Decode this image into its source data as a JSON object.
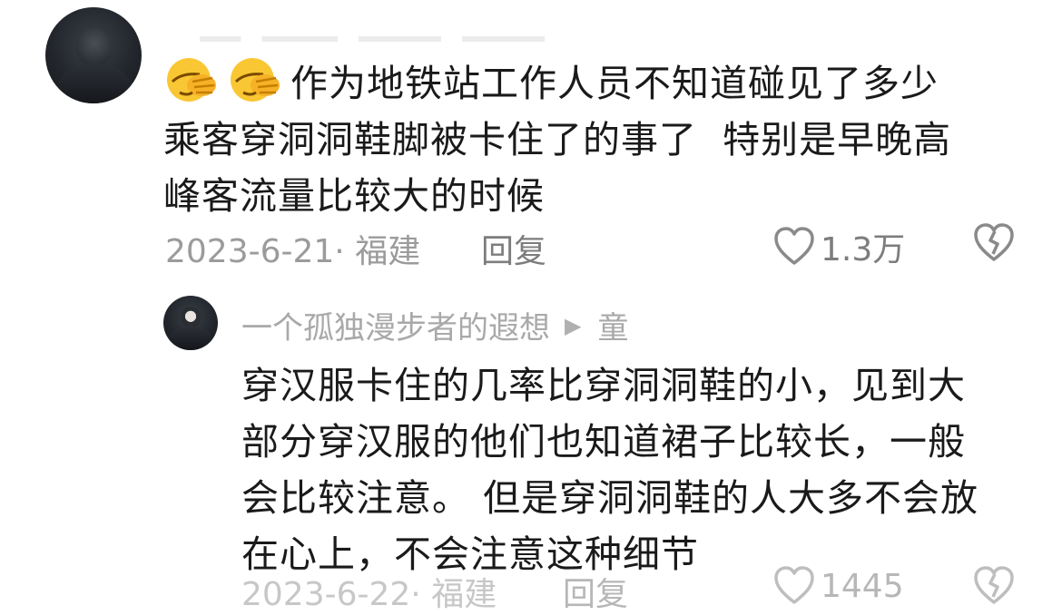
{
  "comment": {
    "text_line1": "作为地铁站工作人员不知道碰见了多少",
    "text_line2": "乘客穿洞洞鞋脚被卡住了的事了  特别是早晚高",
    "text_line3": "峰客流量比较大的时候",
    "date_location": "2023-6-21· 福建",
    "reply_label": "回复",
    "likes": "1.3万",
    "emojis": [
      "facepalm-emoji",
      "facepalm-emoji"
    ]
  },
  "reply": {
    "username": "一个孤独漫步者的遐想",
    "arrow": "▶",
    "reply_to": "童",
    "text_line1": "穿汉服卡住的几率比穿洞洞鞋的小，见到大",
    "text_line2": "部分穿汉服的他们也知道裙子比较长，一般",
    "text_line3": "会比较注意。 但是穿洞洞鞋的人大多不会放",
    "text_line4": "在心上，不会注意这种细节",
    "date_location": "2023-6-22· 福建",
    "reply_label": "回复",
    "likes": "1445"
  },
  "colors": {
    "meta_gray": "#9b9b9b",
    "action_gray": "#7d7d7d",
    "username_gray": "#a9a9a9",
    "text": "#1a1a1a"
  }
}
